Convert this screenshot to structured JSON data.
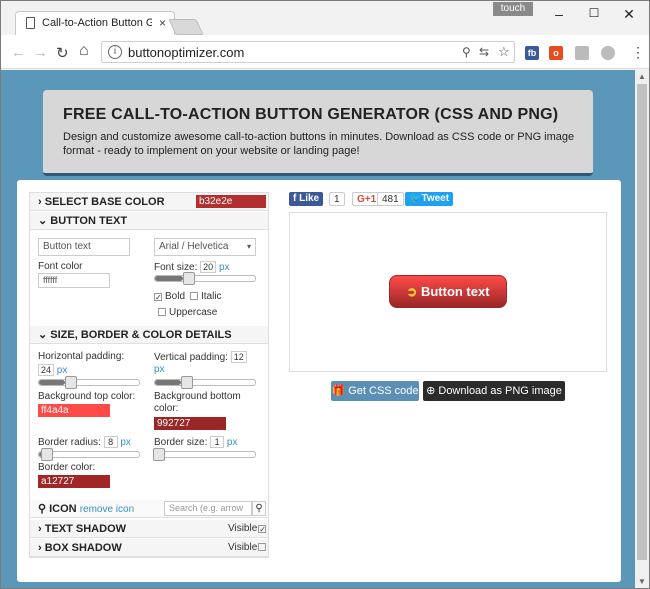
{
  "browser": {
    "tab_title": "Call-to-Action Button G",
    "tab_close": "×",
    "touch_label": "touch",
    "min": "–",
    "max": "☐",
    "close": "✕",
    "back": "←",
    "forward": "→",
    "reload": "↻",
    "home": "⌂",
    "info": "i",
    "url": "buttonoptimizer.com",
    "zoom_icon": "⚲",
    "translate_icon": "⇆",
    "star_icon": "☆",
    "ext1": "fb",
    "ext2": "o",
    "ext3": "",
    "ext4": "",
    "menu": "⋮"
  },
  "hero": {
    "title": "FREE CALL-TO-ACTION BUTTON GENERATOR (CSS AND PNG)",
    "subtitle": "Design and customize awesome call-to-action buttons in minutes. Download as CSS code or PNG image format - ready to implement on your website or landing page!"
  },
  "left": {
    "base_color_label": "SELECT BASE COLOR",
    "base_color": "b32e2e",
    "button_text_label": "BUTTON TEXT",
    "text_value": "Button text",
    "font_family": "Arial / Helvetica",
    "font_color_label": "Font color",
    "font_color": "ffffff",
    "font_size_label": "Font size:",
    "font_size": "20",
    "px": "px",
    "bold_label": "Bold",
    "italic_label": "Italic",
    "uppercase_label": "Uppercase",
    "size_section_label": "SIZE, BORDER & COLOR DETAILS",
    "hpad_label": "Horizontal padding:",
    "hpad": "24",
    "vpad_label": "Vertical padding:",
    "vpad": "12",
    "bg_top_label": "Background top color:",
    "bg_top": "ff4a4a",
    "bg_bottom_label": "Background bottom color:",
    "bg_bottom": "992727",
    "radius_label": "Border radius:",
    "radius": "8",
    "bsize_label": "Border size:",
    "bsize": "1",
    "bcolor_label": "Border color:",
    "bcolor": "a12727",
    "icon_label": "ICON",
    "remove_icon": "remove icon",
    "search_placeholder": "Search (e.g. arrow",
    "text_shadow_label": "TEXT SHADOW",
    "box_shadow_label": "BOX SHADOW",
    "visible": "Visible"
  },
  "right": {
    "fb_like": "Like",
    "fb_count": "1",
    "gplus": "G+1",
    "gplus_count": "481",
    "tweet": "Tweet",
    "button_text": "Button text",
    "button_icon": "➲",
    "get_css": "Get CSS code",
    "download_png": "Download as PNG image"
  },
  "colors": {
    "accent": "#5b97b9",
    "cta_top": "#ff4a4a",
    "cta_bottom": "#992727",
    "base": "#b32e2e"
  }
}
